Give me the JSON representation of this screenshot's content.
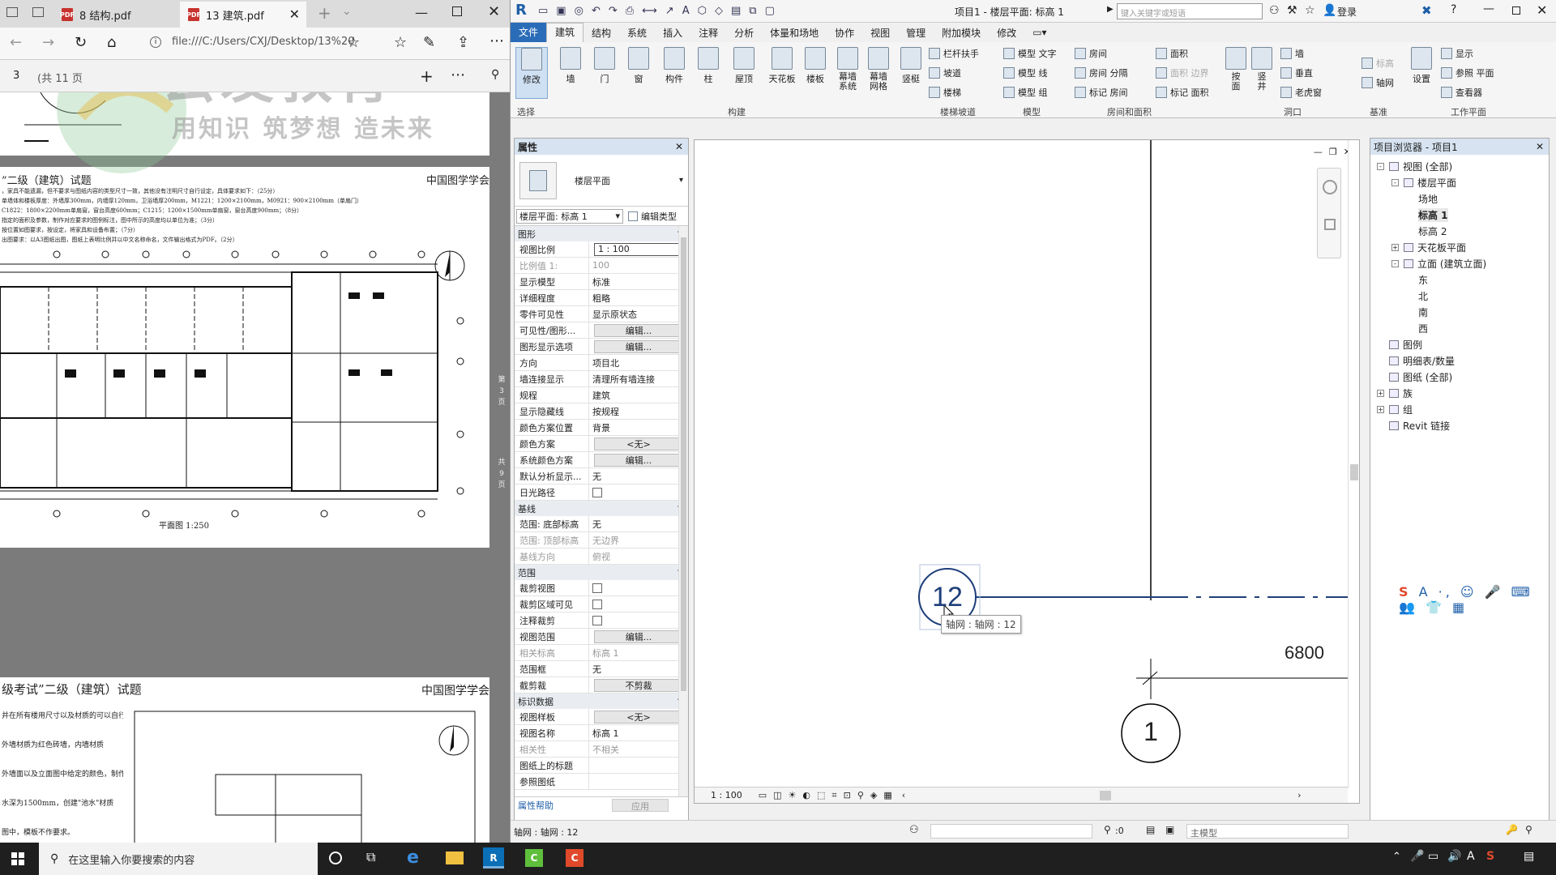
{
  "browser": {
    "tabs": [
      {
        "label": "8 结构.pdf"
      },
      {
        "label": "13 建筑.pdf"
      }
    ],
    "address": "file:///C:/Users/CXJ/Desktop/13%20",
    "page_number": "3",
    "page_total": "(共 11 页",
    "watermark_main": "云发教育",
    "watermark_sub": "用知识 筑梦想 造未来",
    "doc1_title": "”二级（建筑）试题",
    "doc1_org": "中国图学学会",
    "doc1_lines": [
      "，家具不能遗漏，但不要求与图纸内容的类型尺寸一致，其他没有注明尺寸自行设定，具体要求如下：（25分）",
      "单墙体和楼板厚度：外墙厚300mm，内墙厚120mm，卫浴墙厚200mm，M1221：1200×2100mm，M0921：900×2100mm（单扇门）",
      "C1822：1800×2200mm单扇窗，窗台高度600mm；C1215：1200×1500mm单扇窗，窗台高度900mm；（8分）",
      "指定的面积及参数，制作对应要求的图例标注，图中所示的高度均以单位为准；（3分）",
      "按位置如图要求，按设定，将家具和设备布置；（7分）",
      "出图要求：以A3图纸出图，图纸上表明比例并以中文名称命名，文件输出格式为PDF。（2分）"
    ],
    "doc1_scale": "平面图 1:250",
    "doc1_side": [
      "第",
      "3",
      "页",
      "共",
      "9",
      "页"
    ],
    "doc2_title": "级考试”二级（建筑）试题",
    "doc2_org": "中国图学学会",
    "doc2_lines": [
      "并在所有楼用尺寸以及材质的可以自行设定",
      "外墙材质为红色砖墙，内墙材质",
      "外墙面以及立面图中给定的颜色，制作平面图",
      "水深为1500mm，创建\"池水\"材质",
      "图中，模板不作要求。"
    ]
  },
  "revit": {
    "title": "项目1 - 楼层平面: 标高 1",
    "search_placeholder": "键入关键字或短语",
    "login": "登录",
    "tabs": [
      "文件",
      "建筑",
      "结构",
      "系统",
      "插入",
      "注释",
      "分析",
      "体量和场地",
      "协作",
      "视图",
      "管理",
      "附加模块",
      "修改"
    ],
    "ribbon_large": [
      {
        "label": "修改"
      },
      {
        "label": "墙"
      },
      {
        "label": "门"
      },
      {
        "label": "窗"
      },
      {
        "label": "构件"
      },
      {
        "label": "柱"
      },
      {
        "label": "屋顶"
      },
      {
        "label": "天花板"
      },
      {
        "label": "楼板"
      },
      {
        "label": "幕墙系统"
      },
      {
        "label": "幕墙网格"
      },
      {
        "label": "竖梃"
      }
    ],
    "ribbon_small": [
      {
        "label": "栏杆扶手"
      },
      {
        "label": "坡道"
      },
      {
        "label": "楼梯"
      },
      {
        "label": "模型 文字"
      },
      {
        "label": "模型 线"
      },
      {
        "label": "模型 组"
      },
      {
        "label": "房间"
      },
      {
        "label": "房间 分隔"
      },
      {
        "label": "标记 房间"
      },
      {
        "label": "面积"
      },
      {
        "label": "面积 边界"
      },
      {
        "label": "标记 面积"
      },
      {
        "label": "按面"
      },
      {
        "label": "竖井"
      },
      {
        "label": "墙"
      },
      {
        "label": "垂直"
      },
      {
        "label": "老虎窗"
      },
      {
        "label": "标高"
      },
      {
        "label": "轴网"
      },
      {
        "label": "设置"
      },
      {
        "label": "显示"
      },
      {
        "label": "参照 平面"
      },
      {
        "label": "查看器"
      }
    ],
    "groups": [
      "选择",
      "构建",
      "楼梯坡道",
      "模型",
      "房间和面积",
      "洞口",
      "基准",
      "工作平面"
    ],
    "props": {
      "title": "属性",
      "type_name": "楼层平面",
      "instance_sel": "楼层平面: 标高 1",
      "edit_type": "编辑类型",
      "sec_graphics": "图形",
      "rows1": [
        {
          "k": "视图比例",
          "v": "1 : 100"
        },
        {
          "k": "比例值 1:",
          "v": "100"
        },
        {
          "k": "显示模型",
          "v": "标准"
        },
        {
          "k": "详细程度",
          "v": "粗略"
        },
        {
          "k": "零件可见性",
          "v": "显示原状态"
        },
        {
          "k": "可见性/图形...",
          "v": "编辑..."
        },
        {
          "k": "图形显示选项",
          "v": "编辑..."
        },
        {
          "k": "方向",
          "v": "项目北"
        },
        {
          "k": "墙连接显示",
          "v": "清理所有墙连接"
        },
        {
          "k": "规程",
          "v": "建筑"
        },
        {
          "k": "显示隐藏线",
          "v": "按规程"
        },
        {
          "k": "颜色方案位置",
          "v": "背景"
        },
        {
          "k": "颜色方案",
          "v": "<无>"
        },
        {
          "k": "系统颜色方案",
          "v": "编辑..."
        },
        {
          "k": "默认分析显示...",
          "v": "无"
        },
        {
          "k": "日光路径",
          "v": ""
        }
      ],
      "sec_underlay": "基线",
      "rows2": [
        {
          "k": "范围: 底部标高",
          "v": "无"
        },
        {
          "k": "范围: 顶部标高",
          "v": "无边界"
        },
        {
          "k": "基线方向",
          "v": "俯视"
        }
      ],
      "sec_extents": "范围",
      "rows3": [
        {
          "k": "裁剪视图",
          "v": ""
        },
        {
          "k": "裁剪区域可见",
          "v": ""
        },
        {
          "k": "注释裁剪",
          "v": ""
        },
        {
          "k": "视图范围",
          "v": "编辑..."
        },
        {
          "k": "相关标高",
          "v": "标高 1"
        },
        {
          "k": "范围框",
          "v": "无"
        },
        {
          "k": "截剪裁",
          "v": "不剪裁"
        }
      ],
      "sec_identity": "标识数据",
      "rows4": [
        {
          "k": "视图样板",
          "v": "<无>"
        },
        {
          "k": "视图名称",
          "v": "标高 1"
        },
        {
          "k": "相关性",
          "v": "不相关"
        },
        {
          "k": "图纸上的标题",
          "v": ""
        },
        {
          "k": "参照图纸",
          "v": ""
        }
      ],
      "help": "属性帮助",
      "apply": "应用"
    },
    "canvas": {
      "grid_bubble_12": "12",
      "grid_bubble_1": "1",
      "tooltip": "轴网 : 轴网 : 12",
      "dimension": "6800"
    },
    "browser": {
      "title": "项目浏览器 - 项目1",
      "nodes": [
        "视图 (全部)",
        "楼层平面",
        "场地",
        "标高 1",
        "标高 2",
        "天花板平面",
        "立面 (建筑立面)",
        "东",
        "北",
        "南",
        "西",
        "图例",
        "明细表/数量",
        "图纸 (全部)",
        "族",
        "组",
        "Revit 链接"
      ]
    },
    "view_scale": "1 : 100",
    "status_text": "轴网 : 轴网 : 12",
    "status_zero": ":0",
    "status_model": "主模型"
  },
  "taskbar": {
    "search": "在这里输入你要搜索的内容"
  }
}
